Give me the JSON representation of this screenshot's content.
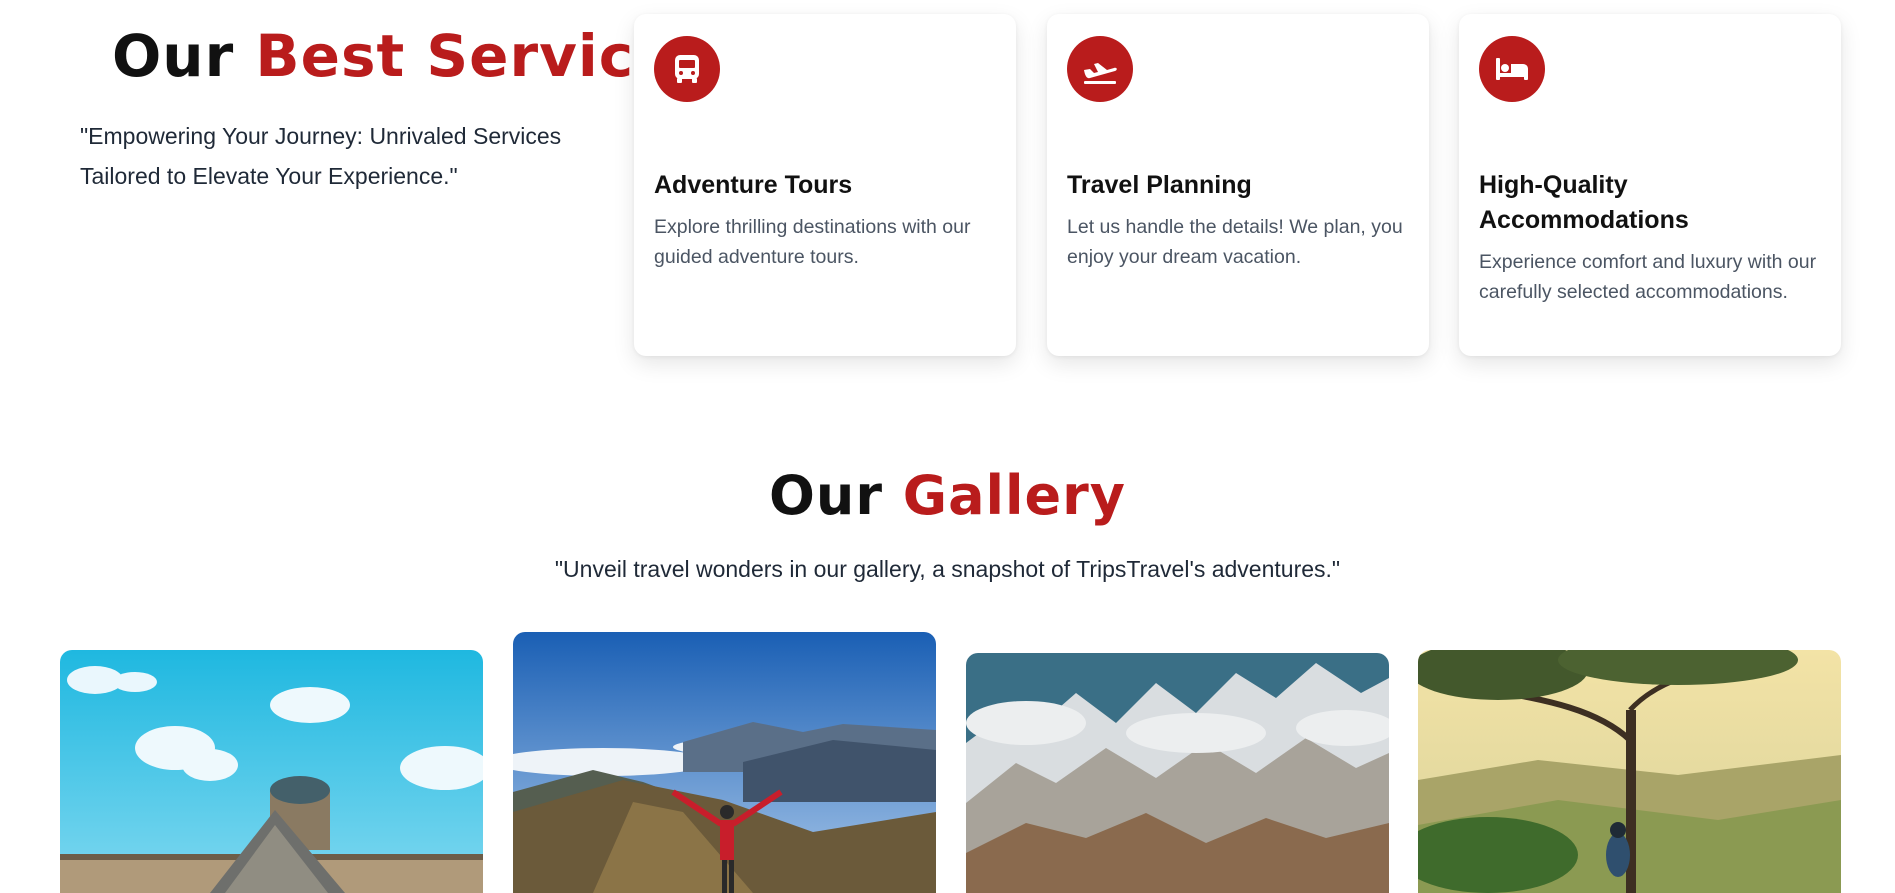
{
  "services": {
    "title_part1": "Our",
    "title_part2": "Best Services",
    "subtitle": "\"Empowering Your Journey: Unrivaled Services Tailored to Elevate Your Experience.\"",
    "cards": [
      {
        "icon": "bus-icon",
        "title": "Adventure Tours",
        "description": "Explore thrilling destinations with our guided adventure tours."
      },
      {
        "icon": "plane-departure-icon",
        "title": "Travel Planning",
        "description": "Let us handle the details! We plan, you enjoy your dream vacation."
      },
      {
        "icon": "bed-icon",
        "title": "High-Quality Accommodations",
        "description": "Experience comfort and luxury with our carefully selected accommodations."
      }
    ]
  },
  "gallery": {
    "title_part1": "Our",
    "title_part2": "Gallery",
    "subtitle": "\"Unveil travel wonders in our gallery, a snapshot of TripsTravel's adventures.\"",
    "images": [
      {
        "subject": "louvre-pyramid"
      },
      {
        "subject": "hiker-on-mountain-peak"
      },
      {
        "subject": "snowy-mountain-range"
      },
      {
        "subject": "tree-over-valley"
      }
    ]
  },
  "colors": {
    "accent": "#b91c1c",
    "text": "#1f2937",
    "muted": "#4b5563"
  }
}
